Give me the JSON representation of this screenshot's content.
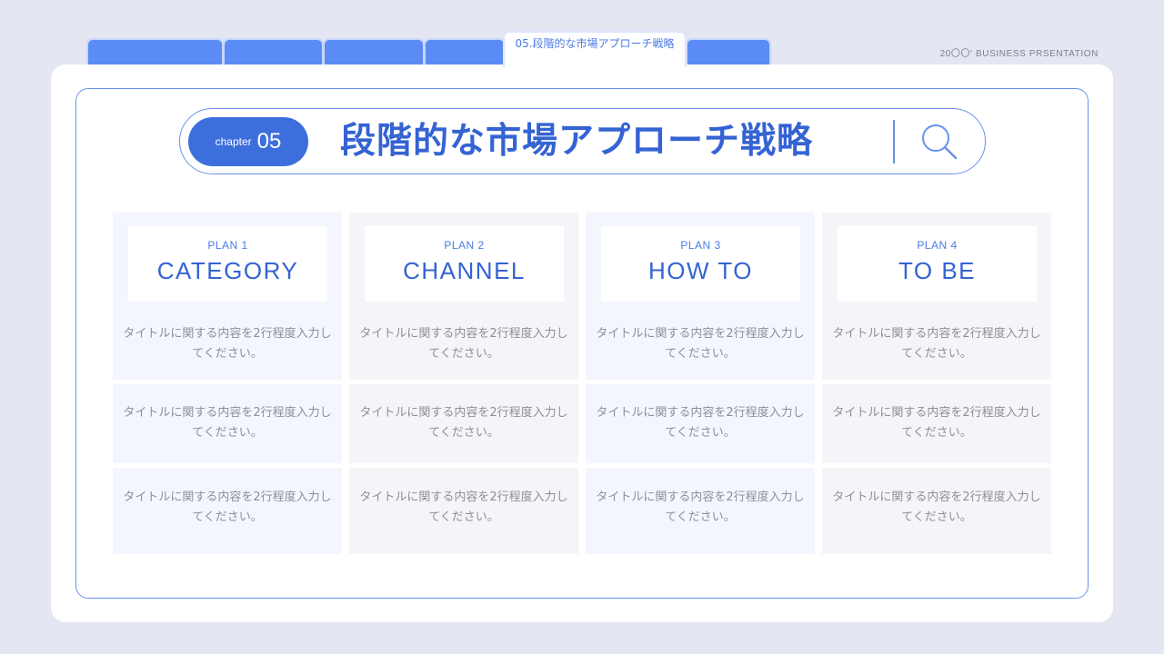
{
  "tabs": [
    {
      "label": ""
    },
    {
      "label": ""
    },
    {
      "label": ""
    },
    {
      "label": ""
    },
    {
      "label": "05.段階的な市場アプローチ戦略"
    },
    {
      "label": ""
    }
  ],
  "brand": "20〇〇' BUSINESS PRSENTATION",
  "chapter": {
    "word": "chapter",
    "number": "05"
  },
  "title": "段階的な市場アプローチ戦略",
  "plans": [
    {
      "label": "PLAN 1",
      "name": "CATEGORY",
      "cells": [
        "タイトルに関する内容を2行程度入力してください。",
        "タイトルに関する内容を2行程度入力してください。",
        "タイトルに関する内容を2行程度入力してください。"
      ]
    },
    {
      "label": "PLAN 2",
      "name": "CHANNEL",
      "cells": [
        "タイトルに関する内容を2行程度入力してください。",
        "タイトルに関する内容を2行程度入力してください。",
        "タイトルに関する内容を2行程度入力してください。"
      ]
    },
    {
      "label": "PLAN 3",
      "name": "HOW TO",
      "cells": [
        "タイトルに関する内容を2行程度入力してください。",
        "タイトルに関する内容を2行程度入力してください。",
        "タイトルに関する内容を2行程度入力してください。"
      ]
    },
    {
      "label": "PLAN 4",
      "name": "TO BE",
      "cells": [
        "タイトルに関する内容を2行程度入力してください。",
        "タイトルに関する内容を2行程度入力してください。",
        "タイトルに関する内容を2行程度入力してください。"
      ]
    }
  ],
  "colors": {
    "accent": "#3d6fdc",
    "tab": "#5b8cf5",
    "background": "#e4e6f1"
  }
}
